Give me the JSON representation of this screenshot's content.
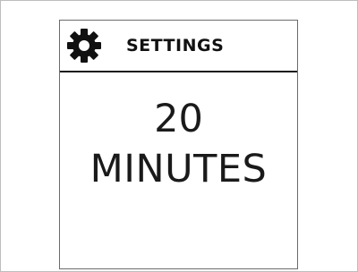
{
  "header": {
    "icon": "gear-icon",
    "label": "SETTINGS"
  },
  "main": {
    "value": "20",
    "unit": "MINUTES"
  }
}
